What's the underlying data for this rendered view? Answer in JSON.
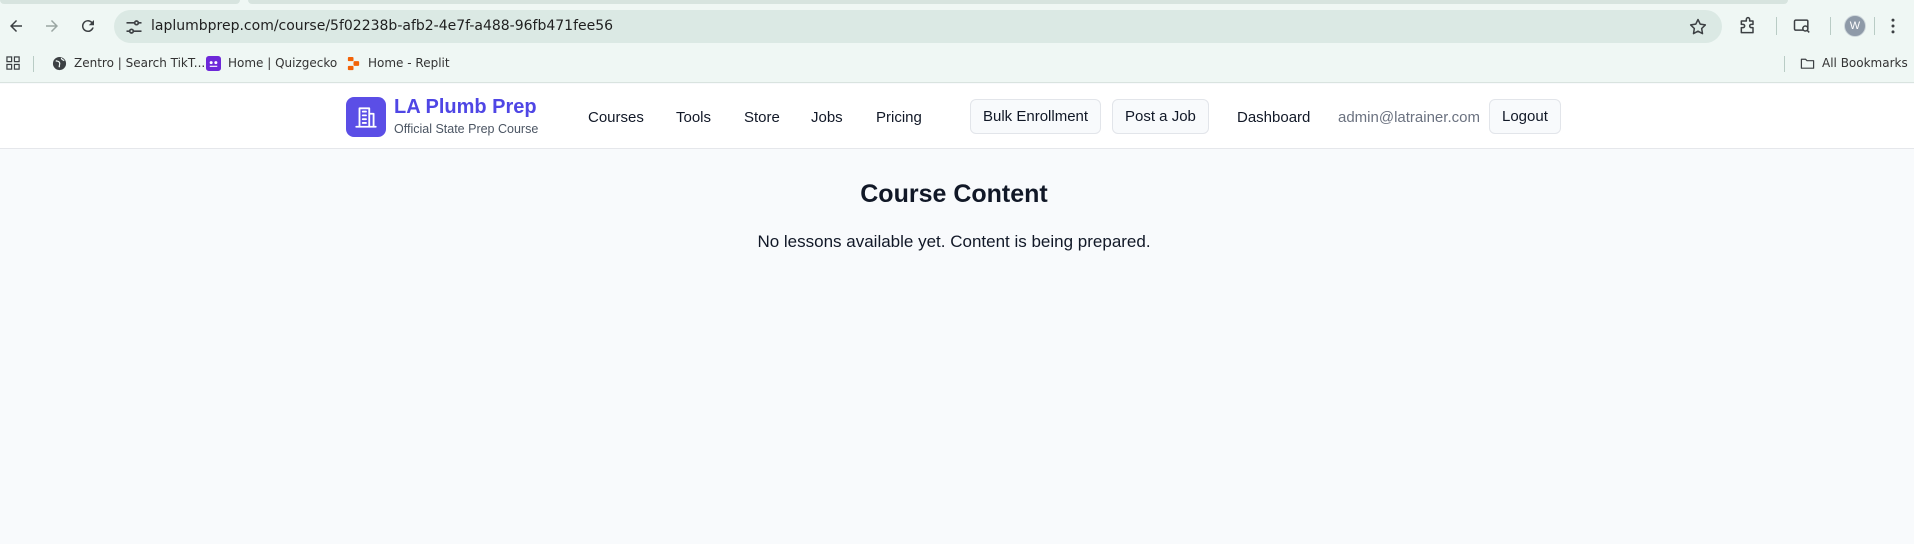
{
  "browser": {
    "url": "laplumbprep.com/course/5f02238b-afb2-4e7f-a488-96fb471fee56",
    "bookmarks": [
      {
        "label": "Zentro | Search TikT...",
        "icon": "globe-icon"
      },
      {
        "label": "Home | Quizgecko",
        "icon": "quizgecko-icon"
      },
      {
        "label": "Home - Replit",
        "icon": "replit-icon"
      }
    ],
    "all_bookmarks_label": "All Bookmarks",
    "profile_initial": "W"
  },
  "site": {
    "brand_title": "LA Plumb Prep",
    "brand_subtitle": "Official State Prep Course",
    "nav": [
      "Courses",
      "Tools",
      "Store",
      "Jobs",
      "Pricing"
    ],
    "bulk_enrollment": "Bulk Enrollment",
    "post_job": "Post a Job",
    "dashboard": "Dashboard",
    "user_email": "admin@latrainer.com",
    "logout": "Logout",
    "accent_color": "#4f46e5"
  },
  "main": {
    "title": "Course Content",
    "message": "No lessons available yet. Content is being prepared."
  }
}
